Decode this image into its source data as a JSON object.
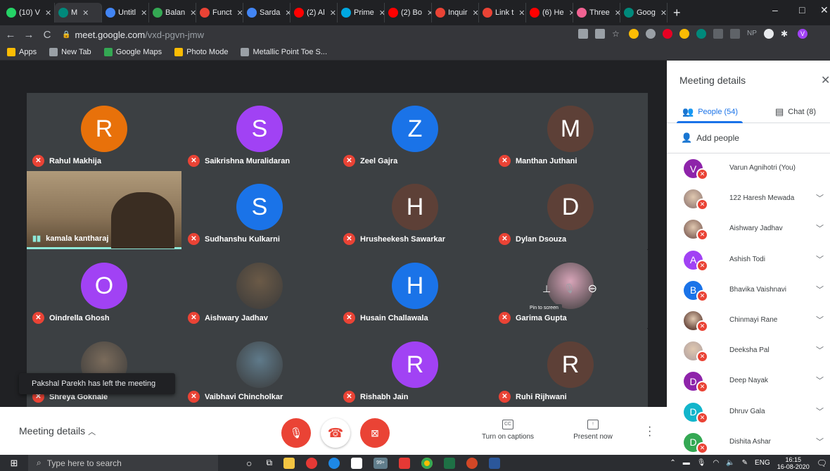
{
  "browser": {
    "tabs": [
      {
        "label": "(10) V",
        "color": "#25d366"
      },
      {
        "label": "M",
        "color": "#00897b",
        "active": true
      },
      {
        "label": "Untitl",
        "color": "#4285f4"
      },
      {
        "label": "Balan",
        "color": "#34a853"
      },
      {
        "label": "Funct",
        "color": "#ea4335"
      },
      {
        "label": "Sarda",
        "color": "#4285f4"
      },
      {
        "label": "(2) Al",
        "color": "#ff0000"
      },
      {
        "label": "Prime",
        "color": "#00a8e1"
      },
      {
        "label": "(2) Bo",
        "color": "#ff0000"
      },
      {
        "label": "Inquir",
        "color": "#ea4335"
      },
      {
        "label": "Link t",
        "color": "#ea4335"
      },
      {
        "label": "(6) He",
        "color": "#ff0000"
      },
      {
        "label": "Three",
        "color": "#f06292"
      },
      {
        "label": "Goog",
        "color": "#00897b"
      }
    ],
    "url_host": "meet.google.com",
    "url_path": "/vxd-pgvn-jmw",
    "bookmarks": [
      {
        "label": "Apps",
        "color": "#fbbc04"
      },
      {
        "label": "New Tab",
        "color": "#9aa0a6"
      },
      {
        "label": "Google Maps",
        "color": "#34a853"
      },
      {
        "label": "Photo Mode",
        "color": "#fbbc04"
      },
      {
        "label": "Metallic Point Toe S...",
        "color": "#9aa0a6"
      }
    ]
  },
  "meeting": {
    "tiles": [
      {
        "name": "Rahul Makhija",
        "initial": "R",
        "color": "#e8710a"
      },
      {
        "name": "Saikrishna Muralidaran",
        "initial": "S",
        "color": "#a142f4"
      },
      {
        "name": "Zeel Gajra",
        "initial": "Z",
        "color": "#1a73e8"
      },
      {
        "name": "Manthan Juthani",
        "initial": "M",
        "color": "#5d4037"
      },
      {
        "name": "kamala kantharaj",
        "initial": "",
        "color": "#8d7a5e",
        "video": true
      },
      {
        "name": "Sudhanshu Kulkarni",
        "initial": "S",
        "color": "#1a73e8"
      },
      {
        "name": "Hrusheekesh Sawarkar",
        "initial": "H",
        "color": "#5d4037"
      },
      {
        "name": "Dylan Dsouza",
        "initial": "D",
        "color": "#5d4037"
      },
      {
        "name": "Oindrella Ghosh",
        "initial": "O",
        "color": "#a142f4"
      },
      {
        "name": "Aishwary Jadhav",
        "initial": "",
        "color": "#6b5a47",
        "photo": true
      },
      {
        "name": "Husain Challawala",
        "initial": "H",
        "color": "#1a73e8"
      },
      {
        "name": "Garima Gupta",
        "initial": "",
        "color": "#d7a4b8",
        "photo": true
      },
      {
        "name": "Shreya Goknale",
        "initial": "",
        "color": "#7a6b5b",
        "photo": true
      },
      {
        "name": "Vaibhavi Chincholkar",
        "initial": "",
        "color": "#5f7a8a",
        "photo": true
      },
      {
        "name": "Rishabh Jain",
        "initial": "R",
        "color": "#a142f4"
      },
      {
        "name": "Ruhi Rijhwani",
        "initial": "R",
        "color": "#5d4037"
      }
    ],
    "toast": "Pakshal Parekh has left the meeting",
    "pin_tooltip": "Pin to screen"
  },
  "bottombar": {
    "details_label": "Meeting details",
    "captions_label": "Turn on captions",
    "present_label": "Present now",
    "cc_icon_text": "CC"
  },
  "panel": {
    "title": "Meeting details",
    "people_tab": "People (54)",
    "chat_tab": "Chat (8)",
    "add_people": "Add people",
    "people": [
      {
        "name": "Varun Agnihotri (You)",
        "initial": "V",
        "color": "#8e24aa",
        "expand": false
      },
      {
        "name": "122 Haresh Mewada",
        "initial": "",
        "color": "#a1887f",
        "expand": true
      },
      {
        "name": "Aishwary Jadhav",
        "initial": "",
        "color": "#8d6e63",
        "expand": true
      },
      {
        "name": "Ashish Todi",
        "initial": "A",
        "color": "#a142f4",
        "expand": true
      },
      {
        "name": "Bhavika Vaishnavi",
        "initial": "B",
        "color": "#1a73e8",
        "expand": true
      },
      {
        "name": "Chinmayi Rane",
        "initial": "",
        "color": "#6d4c41",
        "expand": true
      },
      {
        "name": "Deeksha Pal",
        "initial": "",
        "color": "#bcaaa4",
        "expand": true
      },
      {
        "name": "Deep Nayak",
        "initial": "D",
        "color": "#8e24aa",
        "expand": true
      },
      {
        "name": "Dhruv Gala",
        "initial": "D",
        "color": "#12b5cb",
        "expand": true
      },
      {
        "name": "Dishita Ashar",
        "initial": "D",
        "color": "#34a853",
        "expand": true
      }
    ]
  },
  "taskbar": {
    "search_placeholder": "Type here to search",
    "lang": "ENG",
    "time": "16:15",
    "date": "16-08-2020",
    "badge": "99+"
  }
}
